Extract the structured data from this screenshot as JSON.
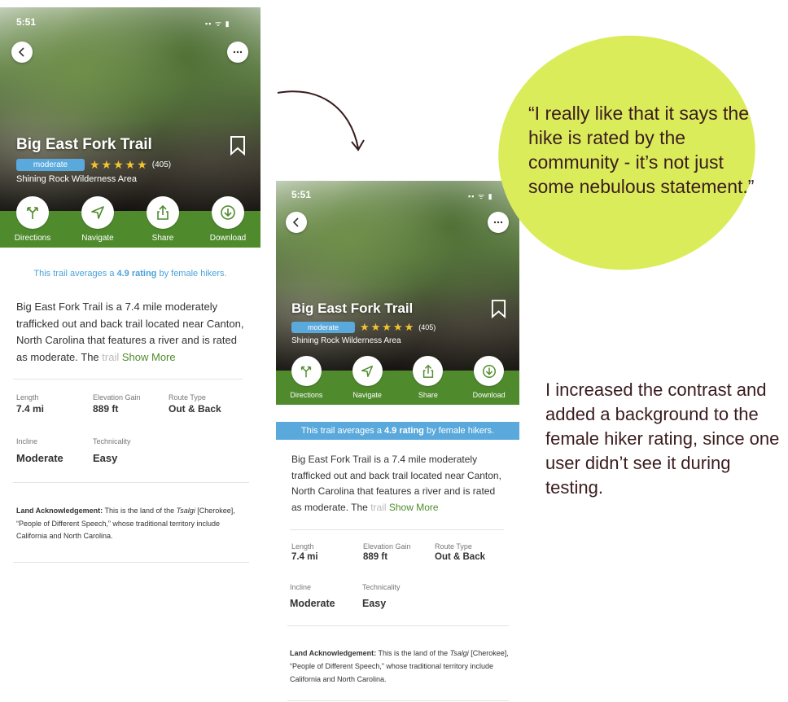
{
  "status": {
    "time": "5:51",
    "icons": "▪▪ ᯤ ▮"
  },
  "trail": {
    "name": "Big East Fork Trail",
    "difficulty": "moderate",
    "stars": "★★★★★",
    "review_count": "(405)",
    "area": "Shining Rock Wilderness Area"
  },
  "actions": [
    {
      "label": "Directions",
      "icon": "directions-icon"
    },
    {
      "label": "Navigate",
      "icon": "navigate-icon"
    },
    {
      "label": "Share",
      "icon": "share-icon"
    },
    {
      "label": "Download",
      "icon": "download-icon"
    }
  ],
  "female_rating": {
    "prefix": "This trail averages a ",
    "value": "4.9 rating",
    "suffix": " by female hikers."
  },
  "description": {
    "main": "Big East Fork Trail is a 7.4 mile moderately trafficked out and back trail located near Canton, North Carolina that features a river and is rated as moderate. The",
    "faded": "trail",
    "show_more": "Show More"
  },
  "stats": {
    "length_label": "Length",
    "length_value": "7.4 mi",
    "elevation_label": "Elevation Gain",
    "elevation_value": "889 ft",
    "route_label": "Route Type",
    "route_value": "Out & Back",
    "incline_label": "Incline",
    "incline_value": "Moderate",
    "technicality_label": "Technicality",
    "technicality_value": "Easy"
  },
  "land": {
    "heading": "Land Acknowledgement:",
    "text1": " This is the land of the ",
    "italic": "Tsalgi",
    "text2": " [Cherokee], “People of Different Speech,” whose traditional territory include California and North Carolina."
  },
  "quote": "“I really like that it says the hike is rated by the community - it’s not just some nebulous statement.”",
  "note": "I increased the contrast and added a background to the female hiker rating, since one user didn’t see it during testing.",
  "colors": {
    "brand_green": "#4f8b2c",
    "rating_blue": "#5aa9dc",
    "star_yellow": "#f4c430",
    "bubble": "#dbec5a",
    "annotation_text": "#3a1c1f"
  }
}
